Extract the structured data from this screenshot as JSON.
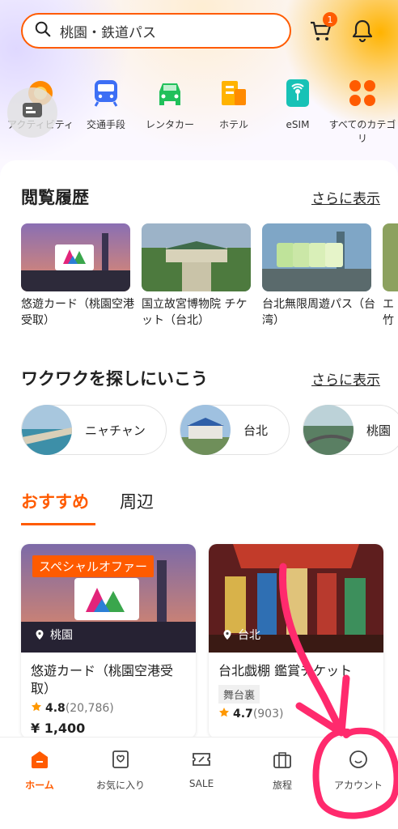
{
  "colors": {
    "accent": "#ff5b00",
    "annotation": "#ff2a6d"
  },
  "search": {
    "query": "桃園・鉄道パス",
    "cart_count": "1"
  },
  "categories": [
    {
      "label": "アクティビティ",
      "icon": "activity-icon"
    },
    {
      "label": "交通手段",
      "icon": "train-icon"
    },
    {
      "label": "レンタカー",
      "icon": "car-icon"
    },
    {
      "label": "ホテル",
      "icon": "hotel-icon"
    },
    {
      "label": "eSIM",
      "icon": "esim-icon"
    },
    {
      "label": "すべてのカテゴリ",
      "icon": "grid-icon"
    }
  ],
  "history": {
    "title": "閲覧履歴",
    "more": "さらに表示",
    "items": [
      {
        "title": "悠遊カード（桃園空港受取）"
      },
      {
        "title": "国立故宮博物院 チケット（台北）"
      },
      {
        "title": "台北無限周遊パス（台湾）"
      },
      {
        "title": "エ竹"
      }
    ]
  },
  "explore": {
    "title": "ワクワクを探しにいこう",
    "more": "さらに表示",
    "places": [
      {
        "name": "ニャチャン"
      },
      {
        "name": "台北"
      },
      {
        "name": "桃園"
      }
    ]
  },
  "tabs": {
    "recommended": "おすすめ",
    "nearby": "周辺"
  },
  "cards": [
    {
      "badge": "スペシャルオファー",
      "location": "桃園",
      "title": "悠遊カード（桃園空港受取）",
      "rating": "4.8",
      "reviews": "(20,786)",
      "price": "¥ 1,400"
    },
    {
      "location": "台北",
      "title": "台北戯棚 鑑賞チケット",
      "tag": "舞台裏",
      "rating": "4.7",
      "reviews": "(903)"
    }
  ],
  "nav": [
    {
      "label": "ホーム",
      "icon": "home-icon"
    },
    {
      "label": "お気に入り",
      "icon": "wishlist-icon"
    },
    {
      "label": "SALE",
      "icon": "coupon-icon"
    },
    {
      "label": "旅程",
      "icon": "suitcase-icon"
    },
    {
      "label": "アカウント",
      "icon": "account-icon"
    }
  ]
}
